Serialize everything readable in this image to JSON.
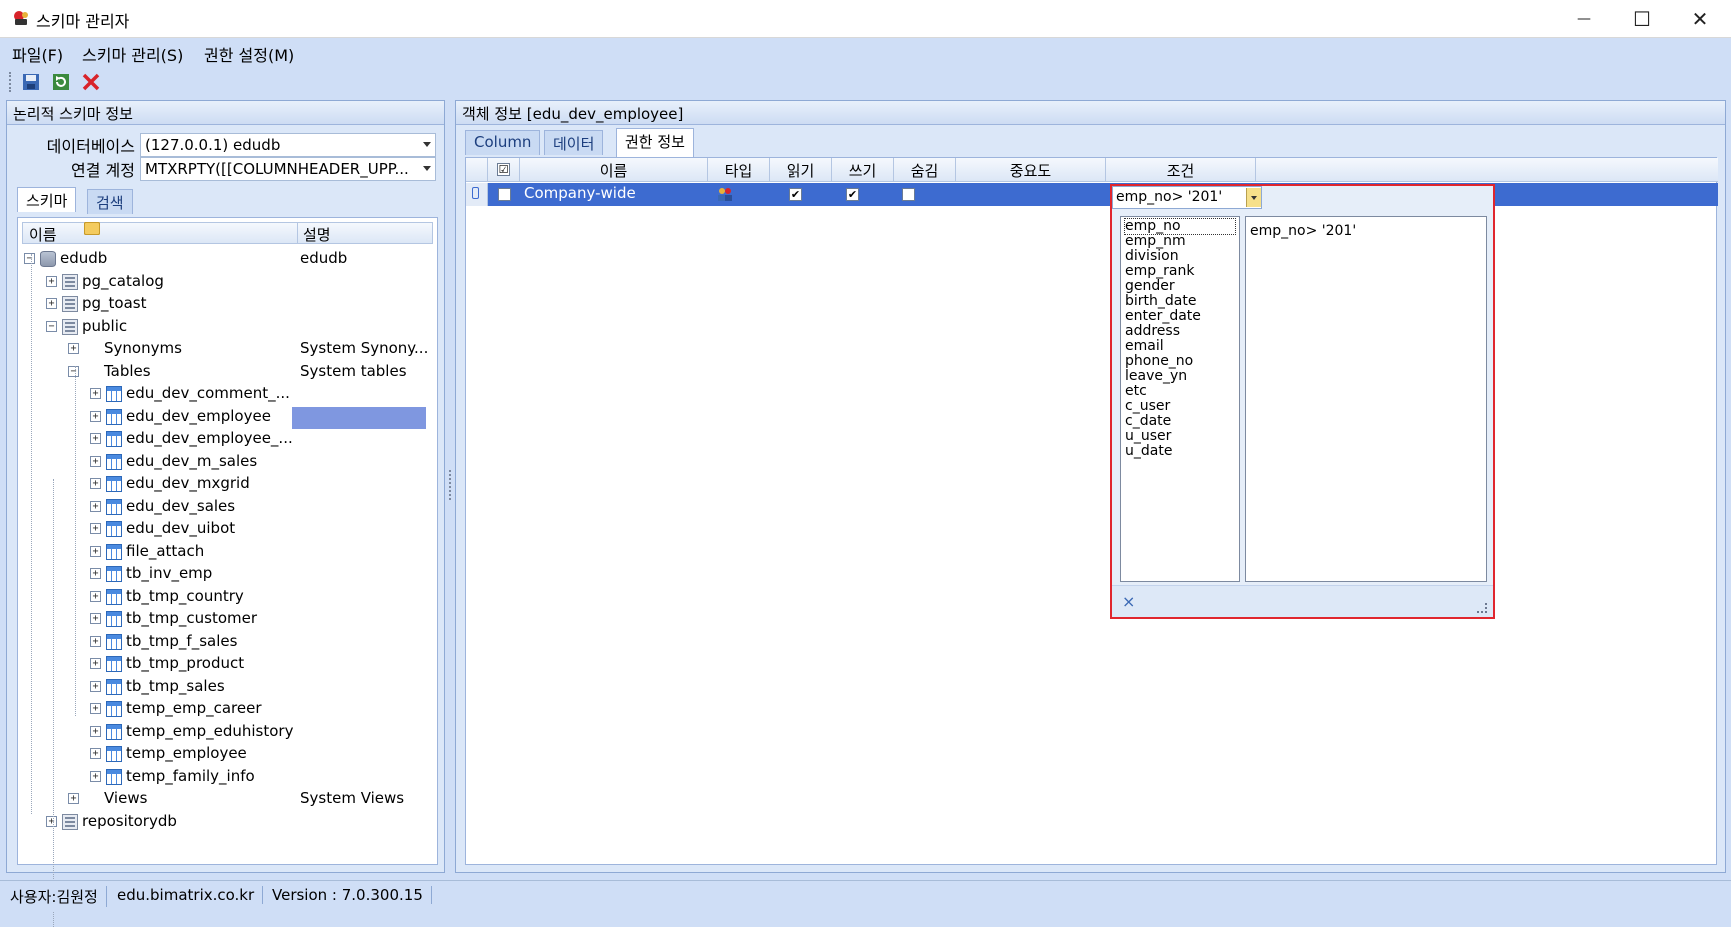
{
  "window": {
    "title": "스키마 관리자",
    "min_glyph": "—",
    "max_glyph": "☐",
    "close_glyph": "✕"
  },
  "menu": [
    "파일(F)",
    "스키마 관리(S)",
    "권한 설정(M)"
  ],
  "toolbar": {
    "icons": [
      "save-icon",
      "refresh-icon",
      "delete-icon"
    ]
  },
  "left": {
    "title": "논리적 스키마 정보",
    "db_label": "데이터베이스",
    "db_value": "(127.0.0.1) edudb",
    "account_label": "연결 계정",
    "account_value": "MTXRPTY([[COLUMNHEADER_UPP...",
    "tabs": [
      "스키마",
      "검색"
    ],
    "tree_headers": [
      "이름",
      "설명"
    ],
    "tree": [
      {
        "label": "edudb",
        "desc": "edudb",
        "level": 0,
        "icon": "database-icon",
        "expander": "−"
      },
      {
        "label": "pg_catalog",
        "desc": "",
        "level": 1,
        "icon": "schema-icon",
        "expander": "+"
      },
      {
        "label": "pg_toast",
        "desc": "",
        "level": 1,
        "icon": "schema-icon",
        "expander": "+"
      },
      {
        "label": "public",
        "desc": "",
        "level": 1,
        "icon": "schema-icon",
        "expander": "−"
      },
      {
        "label": "Synonyms",
        "desc": "System Synony...",
        "level": 2,
        "icon": "folder-icon",
        "expander": "+"
      },
      {
        "label": "Tables",
        "desc": "System tables",
        "level": 2,
        "icon": "folder-icon",
        "expander": "−"
      },
      {
        "label": "edu_dev_comment_...",
        "desc": "",
        "level": 3,
        "icon": "table-icon",
        "expander": "+"
      },
      {
        "label": "edu_dev_employee",
        "desc": "",
        "level": 3,
        "icon": "table-icon",
        "expander": "+",
        "selected": true
      },
      {
        "label": "edu_dev_employee_...",
        "desc": "",
        "level": 3,
        "icon": "table-icon",
        "expander": "+"
      },
      {
        "label": "edu_dev_m_sales",
        "desc": "",
        "level": 3,
        "icon": "table-icon",
        "expander": "+"
      },
      {
        "label": "edu_dev_mxgrid",
        "desc": "",
        "level": 3,
        "icon": "table-icon",
        "expander": "+"
      },
      {
        "label": "edu_dev_sales",
        "desc": "",
        "level": 3,
        "icon": "table-icon",
        "expander": "+"
      },
      {
        "label": "edu_dev_uibot",
        "desc": "",
        "level": 3,
        "icon": "table-icon",
        "expander": "+"
      },
      {
        "label": "file_attach",
        "desc": "",
        "level": 3,
        "icon": "table-icon",
        "expander": "+"
      },
      {
        "label": "tb_inv_emp",
        "desc": "",
        "level": 3,
        "icon": "table-icon",
        "expander": "+"
      },
      {
        "label": "tb_tmp_country",
        "desc": "",
        "level": 3,
        "icon": "table-icon",
        "expander": "+"
      },
      {
        "label": "tb_tmp_customer",
        "desc": "",
        "level": 3,
        "icon": "table-icon",
        "expander": "+"
      },
      {
        "label": "tb_tmp_f_sales",
        "desc": "",
        "level": 3,
        "icon": "table-icon",
        "expander": "+"
      },
      {
        "label": "tb_tmp_product",
        "desc": "",
        "level": 3,
        "icon": "table-icon",
        "expander": "+"
      },
      {
        "label": "tb_tmp_sales",
        "desc": "",
        "level": 3,
        "icon": "table-icon",
        "expander": "+"
      },
      {
        "label": "temp_emp_career",
        "desc": "",
        "level": 3,
        "icon": "table-icon",
        "expander": "+"
      },
      {
        "label": "temp_emp_eduhistory",
        "desc": "",
        "level": 3,
        "icon": "table-icon",
        "expander": "+"
      },
      {
        "label": "temp_employee",
        "desc": "",
        "level": 3,
        "icon": "table-icon",
        "expander": "+"
      },
      {
        "label": "temp_family_info",
        "desc": "",
        "level": 3,
        "icon": "table-icon",
        "expander": "+"
      },
      {
        "label": "Views",
        "desc": "System Views",
        "level": 2,
        "icon": "folder-icon",
        "expander": "+"
      },
      {
        "label": "repositorydb",
        "desc": "",
        "level": 1,
        "icon": "schema-icon",
        "expander": "+"
      }
    ]
  },
  "right": {
    "title": "객체 정보  [edu_dev_employee]",
    "tabs": [
      "Column",
      "데이터",
      "권한 정보"
    ],
    "active_tab": 2,
    "grid_headers": [
      "☑",
      "이름",
      "타입",
      "읽기",
      "쓰기",
      "숨김",
      "중요도",
      "조건"
    ],
    "row": {
      "name": "Company-wide",
      "read": true,
      "write": true,
      "hide": false,
      "condition": "emp_no> '201'"
    }
  },
  "popup": {
    "condition_text": "emp_no> '201'",
    "columns": [
      "emp_no",
      "emp_nm",
      "division",
      "emp_rank",
      "gender",
      "birth_date",
      "enter_date",
      "address",
      "email",
      "phone_no",
      "leave_yn",
      "etc",
      "c_user",
      "c_date",
      "u_user",
      "u_date"
    ],
    "close_glyph": "×"
  },
  "status": [
    "사용자:김원정",
    "edu.bimatrix.co.kr",
    "Version : 7.0.300.15"
  ]
}
